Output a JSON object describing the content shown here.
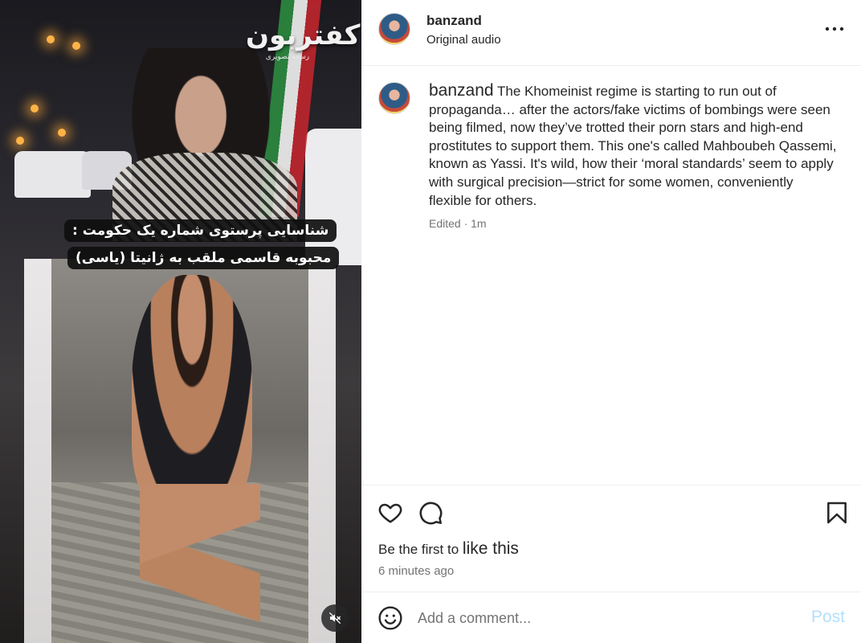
{
  "header": {
    "username": "banzand",
    "audio_label": "Original audio",
    "more_icon": "more-horizontal-icon"
  },
  "media": {
    "overlay_line_1": "شناسایی پرستوی شماره یک حکومت :",
    "overlay_line_2": "محبوبه قاسمی ملقب به ژانیتا (یاسی)",
    "logo_text": "کفتربون",
    "logo_subtext": "رسانه تصویری",
    "mute_icon": "volume-off-icon"
  },
  "caption": {
    "username": "banzand",
    "text": "The Khomeinist regime is starting to run out of propaganda… after the actors/fake victims of bombings were seen being filmed, now they’ve trotted their porn stars and high-end prostitutes to support them. This one's called Mahboubeh Qassemi, known as Yassi. It's wild, how their ‘moral standards’ seem to apply with surgical precision—strict for some women, conveniently flexible for others.",
    "meta": "Edited · 1m"
  },
  "actions": {
    "like_icon": "heart-icon",
    "comment_icon": "comment-icon",
    "save_icon": "bookmark-icon",
    "likes_prefix": "Be the first to",
    "likes_link": "like this",
    "time_ago": "6 minutes ago"
  },
  "comment": {
    "emoji_icon": "emoji-icon",
    "placeholder": "Add a comment...",
    "post_label": "Post",
    "post_color": "#b2dffc"
  }
}
